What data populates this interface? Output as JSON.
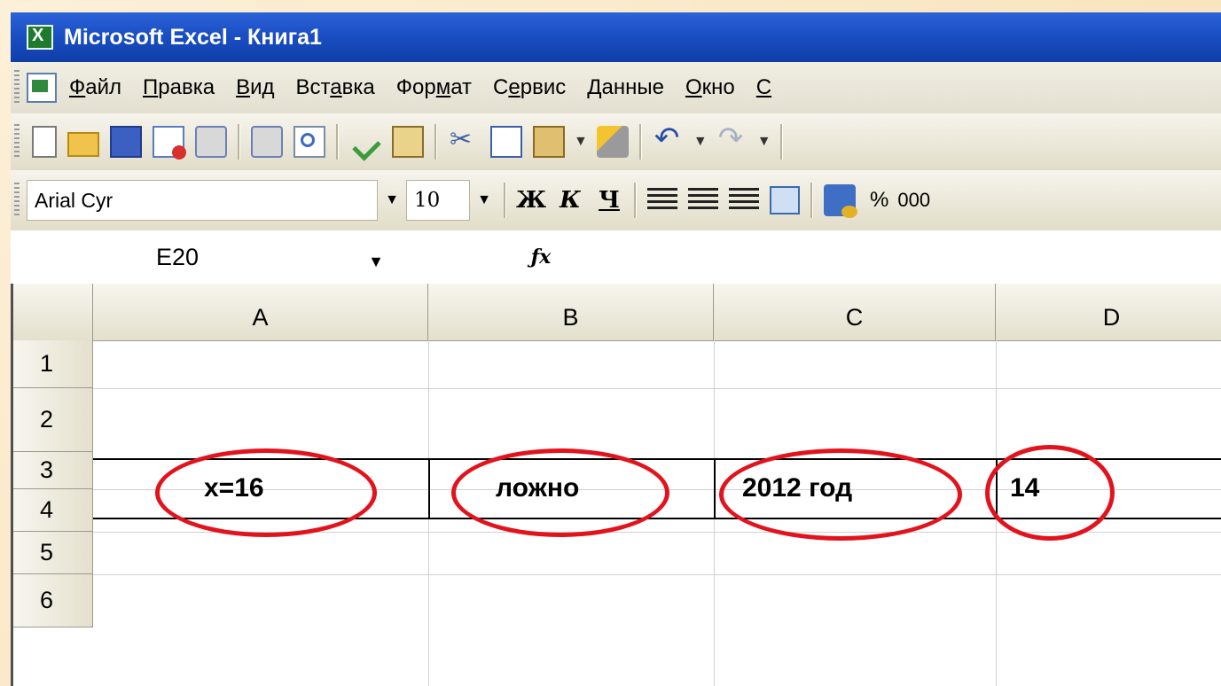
{
  "window": {
    "title": "Microsoft Excel - Книга1"
  },
  "menu": {
    "items": [
      {
        "pre": "",
        "u": "Ф",
        "post": "айл"
      },
      {
        "pre": "",
        "u": "П",
        "post": "равка"
      },
      {
        "pre": "",
        "u": "В",
        "post": "ид"
      },
      {
        "pre": "Вст",
        "u": "а",
        "post": "вка"
      },
      {
        "pre": "Фор",
        "u": "м",
        "post": "ат"
      },
      {
        "pre": "С",
        "u": "е",
        "post": "рвис"
      },
      {
        "pre": "",
        "u": "Д",
        "post": "анные"
      },
      {
        "pre": "",
        "u": "О",
        "post": "кно"
      },
      {
        "pre": "",
        "u": "С",
        "post": ""
      }
    ]
  },
  "formatting": {
    "font": "Arial Cyr",
    "size": "10",
    "bold": "Ж",
    "italic": "К",
    "underline": "Ч",
    "percent": "%",
    "thousands": "000"
  },
  "formula_bar": {
    "name_box": "E20",
    "fx": "fx",
    "formula": ""
  },
  "grid": {
    "columns": [
      "A",
      "B",
      "C",
      "D"
    ],
    "rows": [
      "1",
      "2",
      "3",
      "4",
      "5",
      "6"
    ],
    "row2": {
      "A": "x=16",
      "B": "ложно",
      "C": "2012 год",
      "D": "14"
    }
  },
  "highlight_color": "#e2131c",
  "icons": [
    "excel-app-icon",
    "new-icon",
    "open-icon",
    "save-icon",
    "permission-icon",
    "print-icon",
    "print-preview-icon",
    "spelling-icon",
    "research-icon",
    "cut-icon",
    "copy-icon",
    "paste-icon",
    "format-painter-icon",
    "undo-icon",
    "redo-icon",
    "align-left-icon",
    "align-center-icon",
    "align-right-icon",
    "merge-center-icon",
    "currency-icon"
  ]
}
